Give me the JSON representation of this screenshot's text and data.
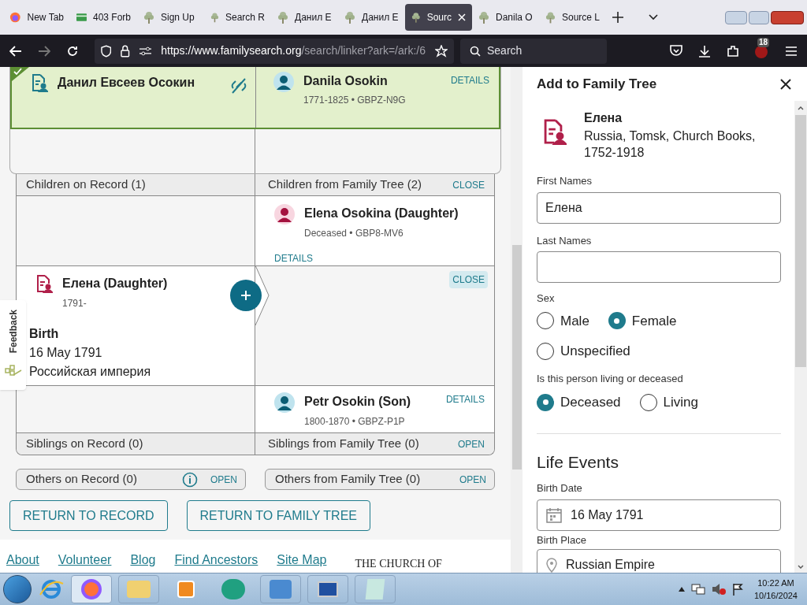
{
  "browser": {
    "tabs": [
      {
        "label": "New Tab",
        "selected": false,
        "kind": "firefox"
      },
      {
        "label": "403 Forb",
        "selected": false,
        "kind": "card"
      },
      {
        "label": "Sign Up",
        "selected": false,
        "kind": "tree"
      },
      {
        "label": "Search R",
        "selected": false,
        "kind": "tree"
      },
      {
        "label": "Данил E",
        "selected": false,
        "kind": "tree"
      },
      {
        "label": "Данил E",
        "selected": false,
        "kind": "tree"
      },
      {
        "label": "Sourc",
        "selected": true,
        "kind": "tree"
      },
      {
        "label": "Danila O",
        "selected": false,
        "kind": "tree"
      },
      {
        "label": "Source L",
        "selected": false,
        "kind": "tree"
      }
    ],
    "url_host": "https://www.familysearch.org",
    "url_path": "/search/linker?ark=/ark:/6",
    "search_placeholder": "Search",
    "badge": "18"
  },
  "couple": {
    "record_name": "Данил Евсеев Осокин",
    "tree_name": "Danila Osokin",
    "tree_meta": "1771-1825 • GBPZ-N9G",
    "details": "DETAILS",
    "matched": true
  },
  "children": {
    "record_header": "Children on Record (1)",
    "tree_header": "Children from Family Tree (2)",
    "close": "CLOSE",
    "tree_child": {
      "name": "Elena Osokina (Daughter)",
      "meta": "Deceased • GBP8-MV6",
      "details": "DETAILS"
    },
    "record_child": {
      "name": "Елена (Daughter)",
      "years": "1791-",
      "close": "CLOSE",
      "event": "Birth",
      "date": "16 May 1791",
      "place": "Российская империя"
    },
    "tree_child_2": {
      "name": "Petr Osokin (Son)",
      "meta": "1800-1870 • GBPZ-P1P",
      "details": "DETAILS"
    }
  },
  "siblings": {
    "record_header": "Siblings on Record (0)",
    "tree_header": "Siblings from Family Tree (0)",
    "open": "OPEN"
  },
  "others": [
    {
      "label": "Others on Record (0)",
      "open": "OPEN",
      "info": true
    },
    {
      "label": "Others from Family Tree (0)",
      "open": "OPEN",
      "info": false
    }
  ],
  "buttons": [
    "RETURN TO RECORD",
    "RETURN TO FAMILY TREE"
  ],
  "feedback": "Feedback",
  "footer": {
    "links": [
      "About",
      "Volunteer",
      "Blog",
      "Find Ancestors",
      "Site Map"
    ],
    "church": "THE CHURCH OF"
  },
  "panel": {
    "title": "Add to Family Tree",
    "record_name": "Елена",
    "collection": "Russia, Tomsk, Church Books, 1752-1918",
    "first_names_label": "First Names",
    "first_names": "Елена",
    "last_names_label": "Last Names",
    "sex_label": "Sex",
    "sex": [
      {
        "label": "Male",
        "selected": false
      },
      {
        "label": "Female",
        "selected": true
      },
      {
        "label": "Unspecified",
        "selected": false
      }
    ],
    "status_label": "Is this person living or deceased",
    "status": [
      {
        "label": "Deceased",
        "selected": true
      },
      {
        "label": "Living",
        "selected": false
      }
    ],
    "section": "Life Events",
    "birth_date_label": "Birth Date",
    "birth_date": "16 May 1791",
    "birth_place_label": "Birth Place",
    "birth_place": "Russian Empire"
  },
  "taskbar": {
    "time": "10:22 AM",
    "date": "10/16/2024"
  }
}
